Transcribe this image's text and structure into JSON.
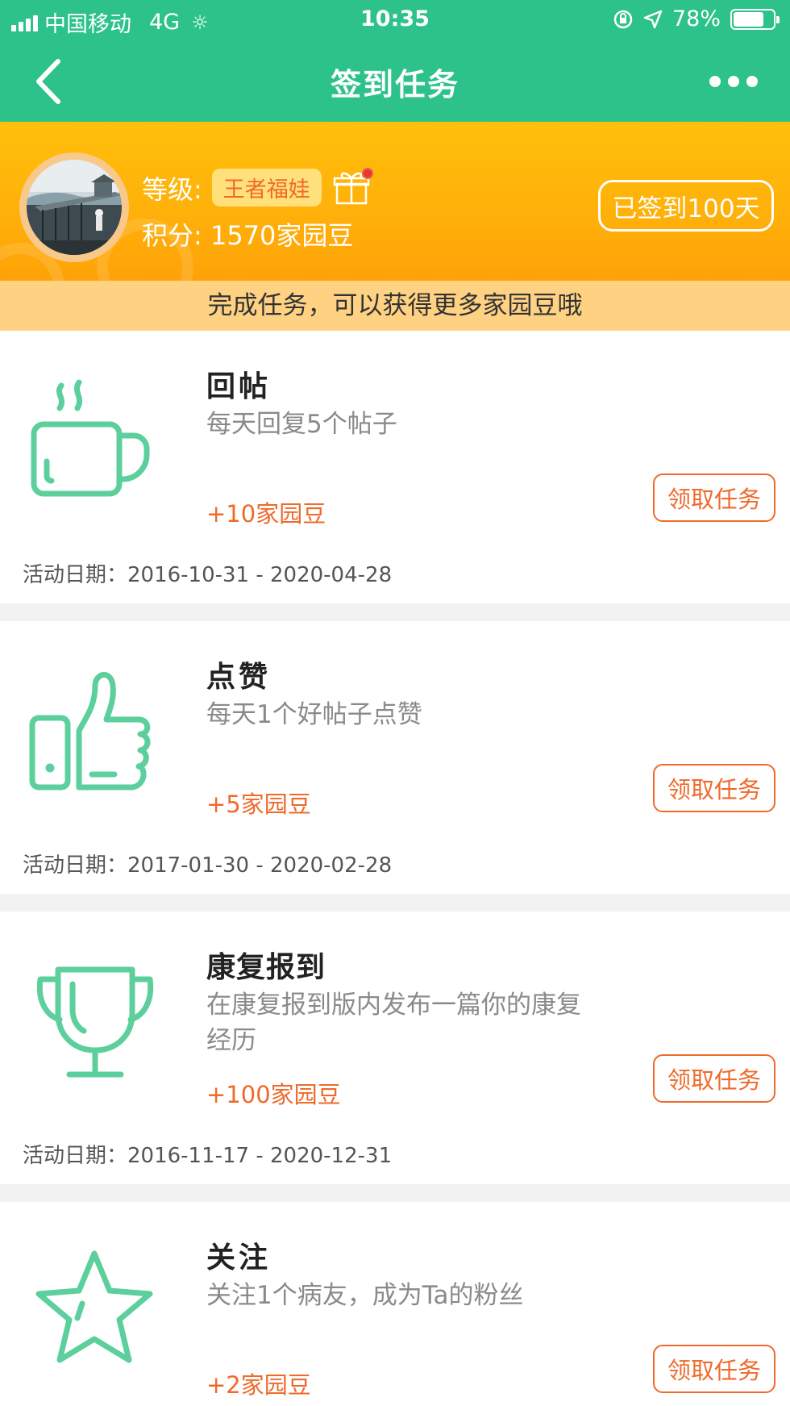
{
  "status_bar": {
    "carrier": "中国移动",
    "network": "4G",
    "loading_glyph": "☼",
    "time": "10:35",
    "battery": "78%",
    "battery_level": 0.78
  },
  "nav": {
    "title": "签到任务"
  },
  "profile": {
    "level_label": "等级:",
    "level_value": "王者福娃",
    "points_label": "积分:",
    "points_value": "1570家园豆",
    "checkin_label": "已签到100天"
  },
  "banner": "完成任务，可以获得更多家园豆哦",
  "tasks": [
    {
      "icon": "coffee-cup-icon",
      "title": "回帖",
      "desc": "每天回复5个帖子",
      "reward": "+10家园豆",
      "button": "领取任务",
      "date": "活动日期：2016-10-31 - 2020-04-28"
    },
    {
      "icon": "thumbs-up-icon",
      "title": "点赞",
      "desc": "每天1个好帖子点赞",
      "reward": "+5家园豆",
      "button": "领取任务",
      "date": "活动日期：2017-01-30 - 2020-02-28"
    },
    {
      "icon": "trophy-icon",
      "title": "康复报到",
      "desc": "在康复报到版内发布一篇你的康复经历",
      "reward": "+100家园豆",
      "button": "领取任务",
      "date": "活动日期：2016-11-17 - 2020-12-31"
    },
    {
      "icon": "star-icon",
      "title": "关注",
      "desc": "关注1个病友，成为Ta的粉丝",
      "reward": "+2家园豆",
      "button": "领取任务",
      "date": ""
    }
  ],
  "colors": {
    "primary_green": "#2cc28a",
    "icon_green": "#5ccf9c",
    "header_orange": "#ffb10a",
    "accent_orange": "#ef6a2b",
    "banner_bg": "#ffd183"
  }
}
